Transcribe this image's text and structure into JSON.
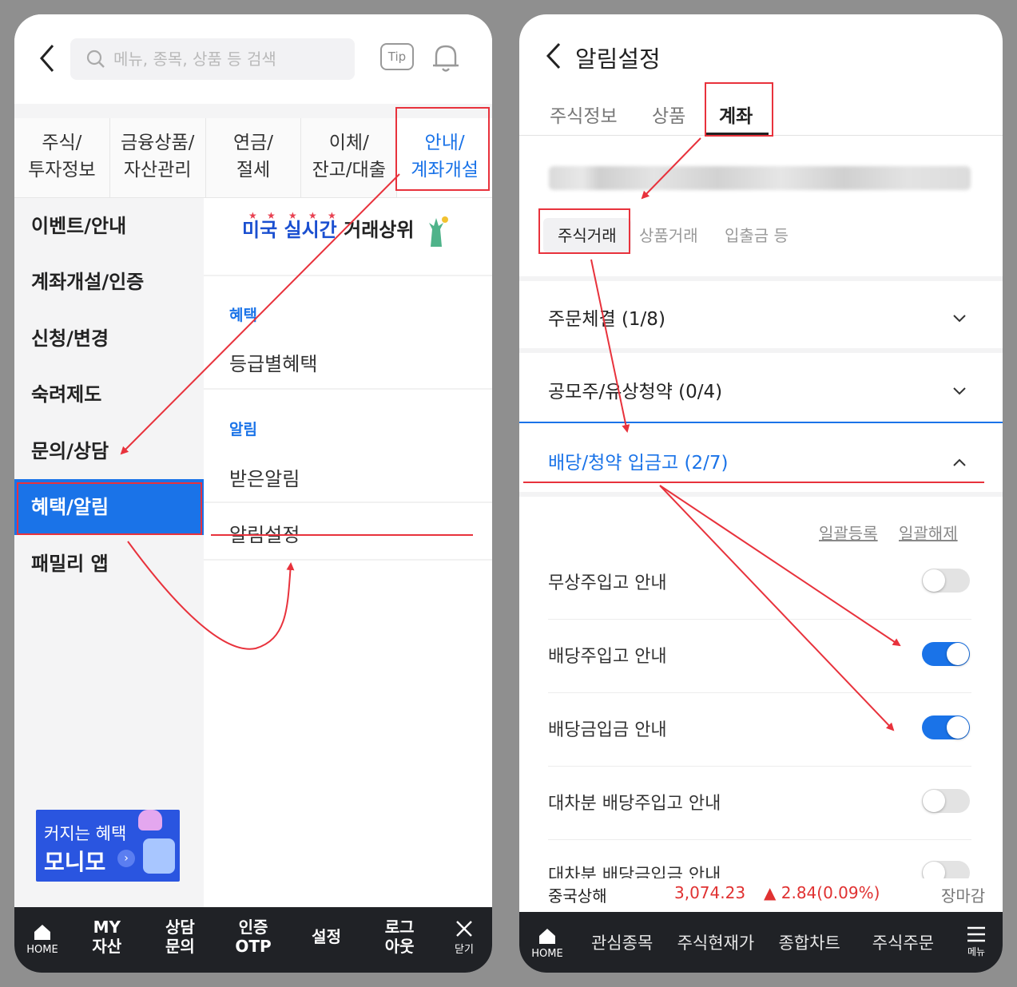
{
  "left": {
    "search_placeholder": "메뉴, 종목, 상품 등 검색",
    "tip_label": "Tip",
    "categories": [
      {
        "label": "주식/\n투자정보"
      },
      {
        "label": "금융상품/\n자산관리"
      },
      {
        "label": "연금/\n절세"
      },
      {
        "label": "이체/\n잔고/대출"
      },
      {
        "label": "안내/\n계좌개설"
      }
    ],
    "side_items": [
      {
        "label": "이벤트/안내"
      },
      {
        "label": "계좌개설/인증"
      },
      {
        "label": "신청/변경"
      },
      {
        "label": "숙려제도"
      },
      {
        "label": "문의/상담"
      },
      {
        "label": "혜택/알림"
      },
      {
        "label": "패밀리 앱"
      }
    ],
    "promo_blue": "미국 실시간",
    "promo_black": "거래상위",
    "sections": [
      {
        "label": "혜택",
        "items": [
          "등급별혜택"
        ]
      },
      {
        "label": "알림",
        "items": [
          "받은알림",
          "알림설정"
        ]
      }
    ],
    "banner": {
      "line1": "커지는 혜택",
      "line2": "모니모"
    },
    "bottom_nav": {
      "home": "HOME",
      "items": [
        "MY\n자산",
        "상담\n문의",
        "인증\nOTP",
        "설정",
        "로그\n아웃"
      ],
      "close": "닫기"
    }
  },
  "right": {
    "title": "알림설정",
    "tabs": [
      "주식정보",
      "상품",
      "계좌"
    ],
    "subtabs": [
      "주식거래",
      "상품거래",
      "입출금 등"
    ],
    "accordions": [
      {
        "label": "주문체결 (1/8)"
      },
      {
        "label": "공모주/유상청약 (0/4)"
      },
      {
        "label": "배당/청약 입금고 (2/7)"
      }
    ],
    "bulk_register": "일괄등록",
    "bulk_release": "일괄해제",
    "toggles": [
      {
        "label": "무상주입고 안내",
        "on": false
      },
      {
        "label": "배당주입고 안내",
        "on": true
      },
      {
        "label": "배당금입금 안내",
        "on": true
      },
      {
        "label": "대차분 배당주입고 안내",
        "on": false
      },
      {
        "label": "대차분 배당금입금 안내",
        "on": false
      }
    ],
    "ticker": {
      "name": "중국상해",
      "value": "3,074.23",
      "change": "▲ 2.84(0.09%)",
      "status": "장마감"
    },
    "bottom_nav": {
      "home": "HOME",
      "items": [
        "관심종목",
        "주식현재가",
        "종합차트",
        "주식주문"
      ],
      "menu": "메뉴"
    }
  },
  "colors": {
    "accent": "#1a73e8",
    "annotation": "#e8323c",
    "nav_bg": "#202226",
    "up": "#e03131"
  }
}
